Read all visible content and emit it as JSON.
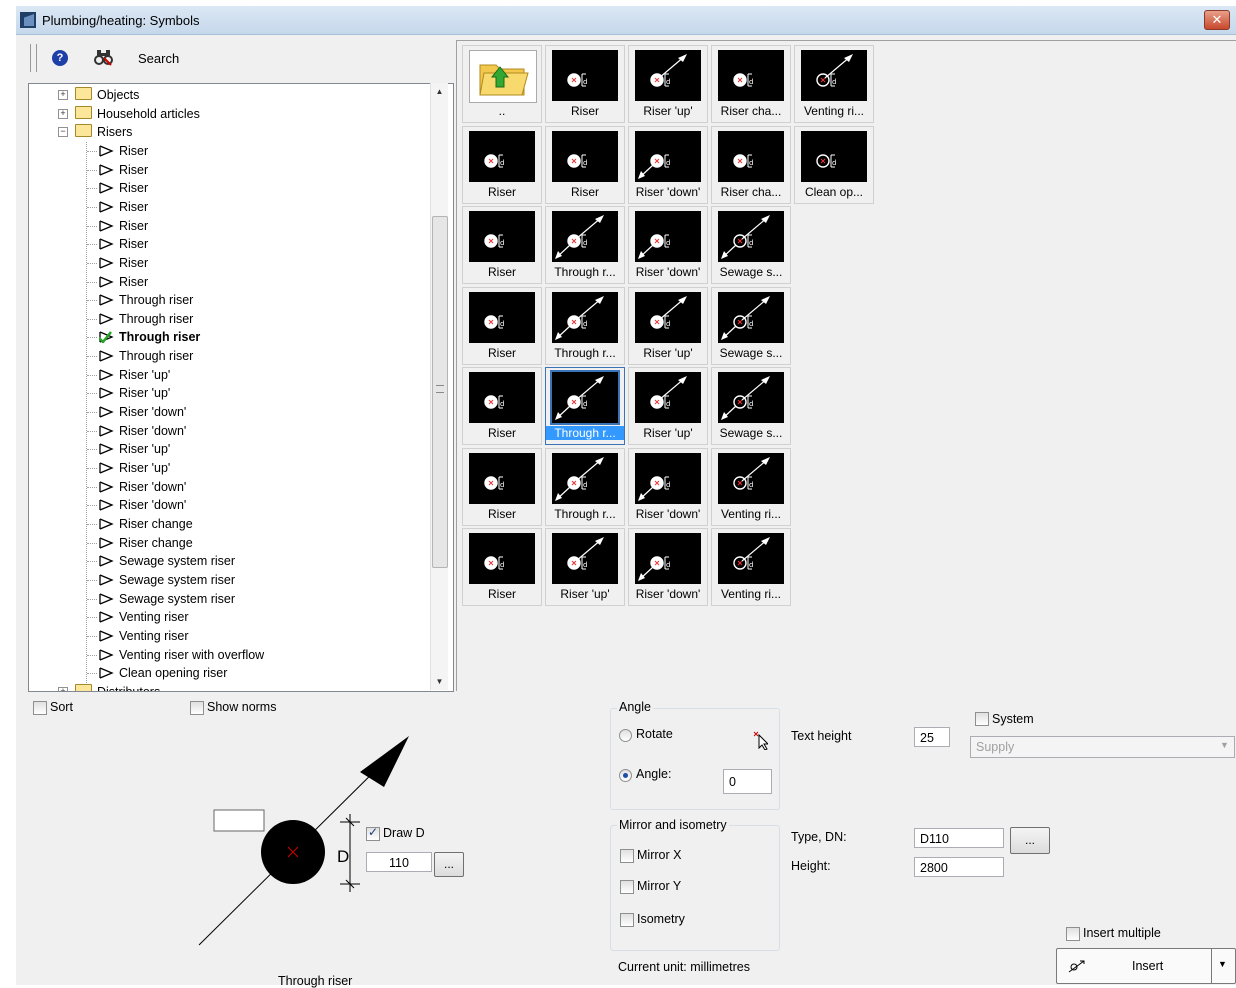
{
  "window": {
    "title": "Plumbing/heating: Symbols",
    "close_glyph": "✕"
  },
  "toolbar": {
    "search_label": "Search",
    "help_glyph": "?",
    "search_icon": "binoculars-icon"
  },
  "tree": {
    "folders_top": [
      {
        "label": "Objects",
        "expander": "+"
      },
      {
        "label": "Household articles",
        "expander": "+"
      },
      {
        "label": "Risers",
        "expander": "−"
      }
    ],
    "items": [
      "Riser",
      "Riser",
      "Riser",
      "Riser",
      "Riser",
      "Riser",
      "Riser",
      "Riser",
      "Through riser",
      "Through riser",
      "Through riser",
      "Through riser",
      "Riser 'up'",
      "Riser 'up'",
      "Riser 'down'",
      "Riser 'down'",
      "Riser 'up'",
      "Riser 'up'",
      "Riser 'down'",
      "Riser 'down'",
      "Riser change",
      "Riser change",
      "Sewage system riser",
      "Sewage system riser",
      "Sewage system riser",
      "Venting riser",
      "Venting riser",
      "Venting riser with overflow",
      "Clean opening riser"
    ],
    "selected_index": 10,
    "partial_folder": "Distributors"
  },
  "grid": {
    "rows": [
      [
        "..",
        "Riser",
        "Riser 'up'",
        "Riser cha...",
        "Venting ri..."
      ],
      [
        "Riser",
        "Riser",
        "Riser 'down'",
        "Riser cha...",
        "Clean op..."
      ],
      [
        "Riser",
        "Through r...",
        "Riser 'down'",
        "Sewage s..."
      ],
      [
        "Riser",
        "Through r...",
        "Riser 'up'",
        "Sewage s..."
      ],
      [
        "Riser",
        "Through r...",
        "Riser 'up'",
        "Sewage s..."
      ],
      [
        "Riser",
        "Through r...",
        "Riser 'down'",
        "Venting ri..."
      ],
      [
        "Riser",
        "Riser 'up'",
        "Riser 'down'",
        "Venting ri..."
      ]
    ],
    "selected": {
      "row": 4,
      "col": 1
    }
  },
  "options": {
    "sort": "Sort",
    "show_norms": "Show norms",
    "sort_checked": false,
    "show_norms_checked": false
  },
  "preview": {
    "draw_d_label": "Draw D",
    "draw_d_checked": true,
    "d_value": "110",
    "d_letter": "D",
    "browse": "...",
    "caption": "Through riser"
  },
  "angle": {
    "group": "Angle",
    "rotate": "Rotate",
    "angle_label": "Angle:",
    "angle_value": "0",
    "selected": "angle"
  },
  "mirror": {
    "group": "Mirror and isometry",
    "mirror_x": "Mirror X",
    "mirror_y": "Mirror Y",
    "isometry": "Isometry"
  },
  "props": {
    "text_height_label": "Text height",
    "text_height": "25",
    "system_label": "System",
    "system_checked": false,
    "system_value": "Supply",
    "type_dn_label": "Type, DN:",
    "type_dn": "D110",
    "browse": "...",
    "height_label": "Height:",
    "height": "2800",
    "unit": "Current unit: millimetres",
    "insert_multiple": "Insert multiple",
    "insert": "Insert"
  }
}
